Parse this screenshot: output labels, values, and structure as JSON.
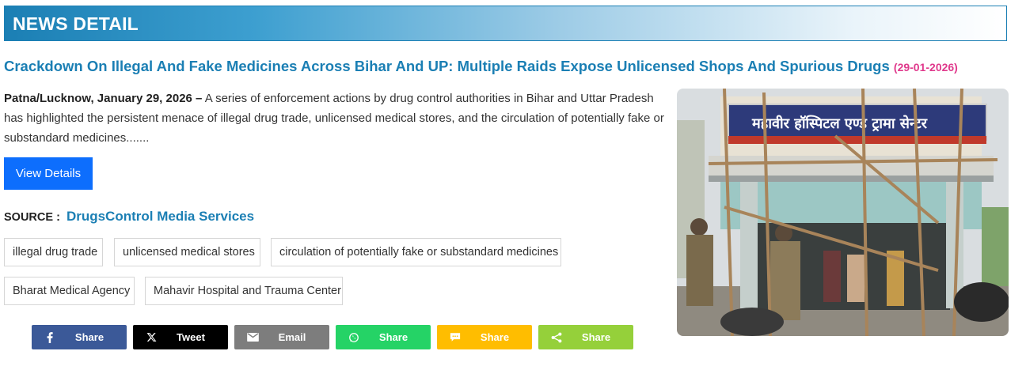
{
  "header": {
    "title": "NEWS DETAIL"
  },
  "article": {
    "title": "Crackdown On Illegal And Fake Medicines Across Bihar And UP: Multiple Raids Expose Unlicensed Shops And Spurious Drugs",
    "date": "(29-01-2026)",
    "dateline": "Patna/Lucknow, January 29, 2026 –",
    "summary": " A series of enforcement actions by drug control authorities in Bihar and Uttar Pradesh has highlighted the persistent menace of illegal drug trade, unlicensed medical stores, and the circulation of potentially fake or substandard medicines.......",
    "view_button": "View Details",
    "source_label": "SOURCE :",
    "source_value": "DrugsControl Media Services",
    "image_sign_text": "महावीर हॉस्पिटल एण्ड ट्रामा सेन्टर"
  },
  "tags": [
    "illegal drug trade",
    "unlicensed medical stores",
    "circulation of potentially fake or substandard medicines",
    "Bharat Medical Agency",
    "Mahavir Hospital and Trauma Center"
  ],
  "share_buttons": [
    {
      "label": "Share",
      "icon": "facebook-icon",
      "color": "#3b5998"
    },
    {
      "label": "Tweet",
      "icon": "x-icon",
      "color": "#000000"
    },
    {
      "label": "Email",
      "icon": "email-icon",
      "color": "#7d7d7d"
    },
    {
      "label": "Share",
      "icon": "whatsapp-icon",
      "color": "#25d366"
    },
    {
      "label": "Share",
      "icon": "sms-icon",
      "color": "#ffbd00"
    },
    {
      "label": "Share",
      "icon": "sharethis-icon",
      "color": "#95d03a"
    }
  ]
}
